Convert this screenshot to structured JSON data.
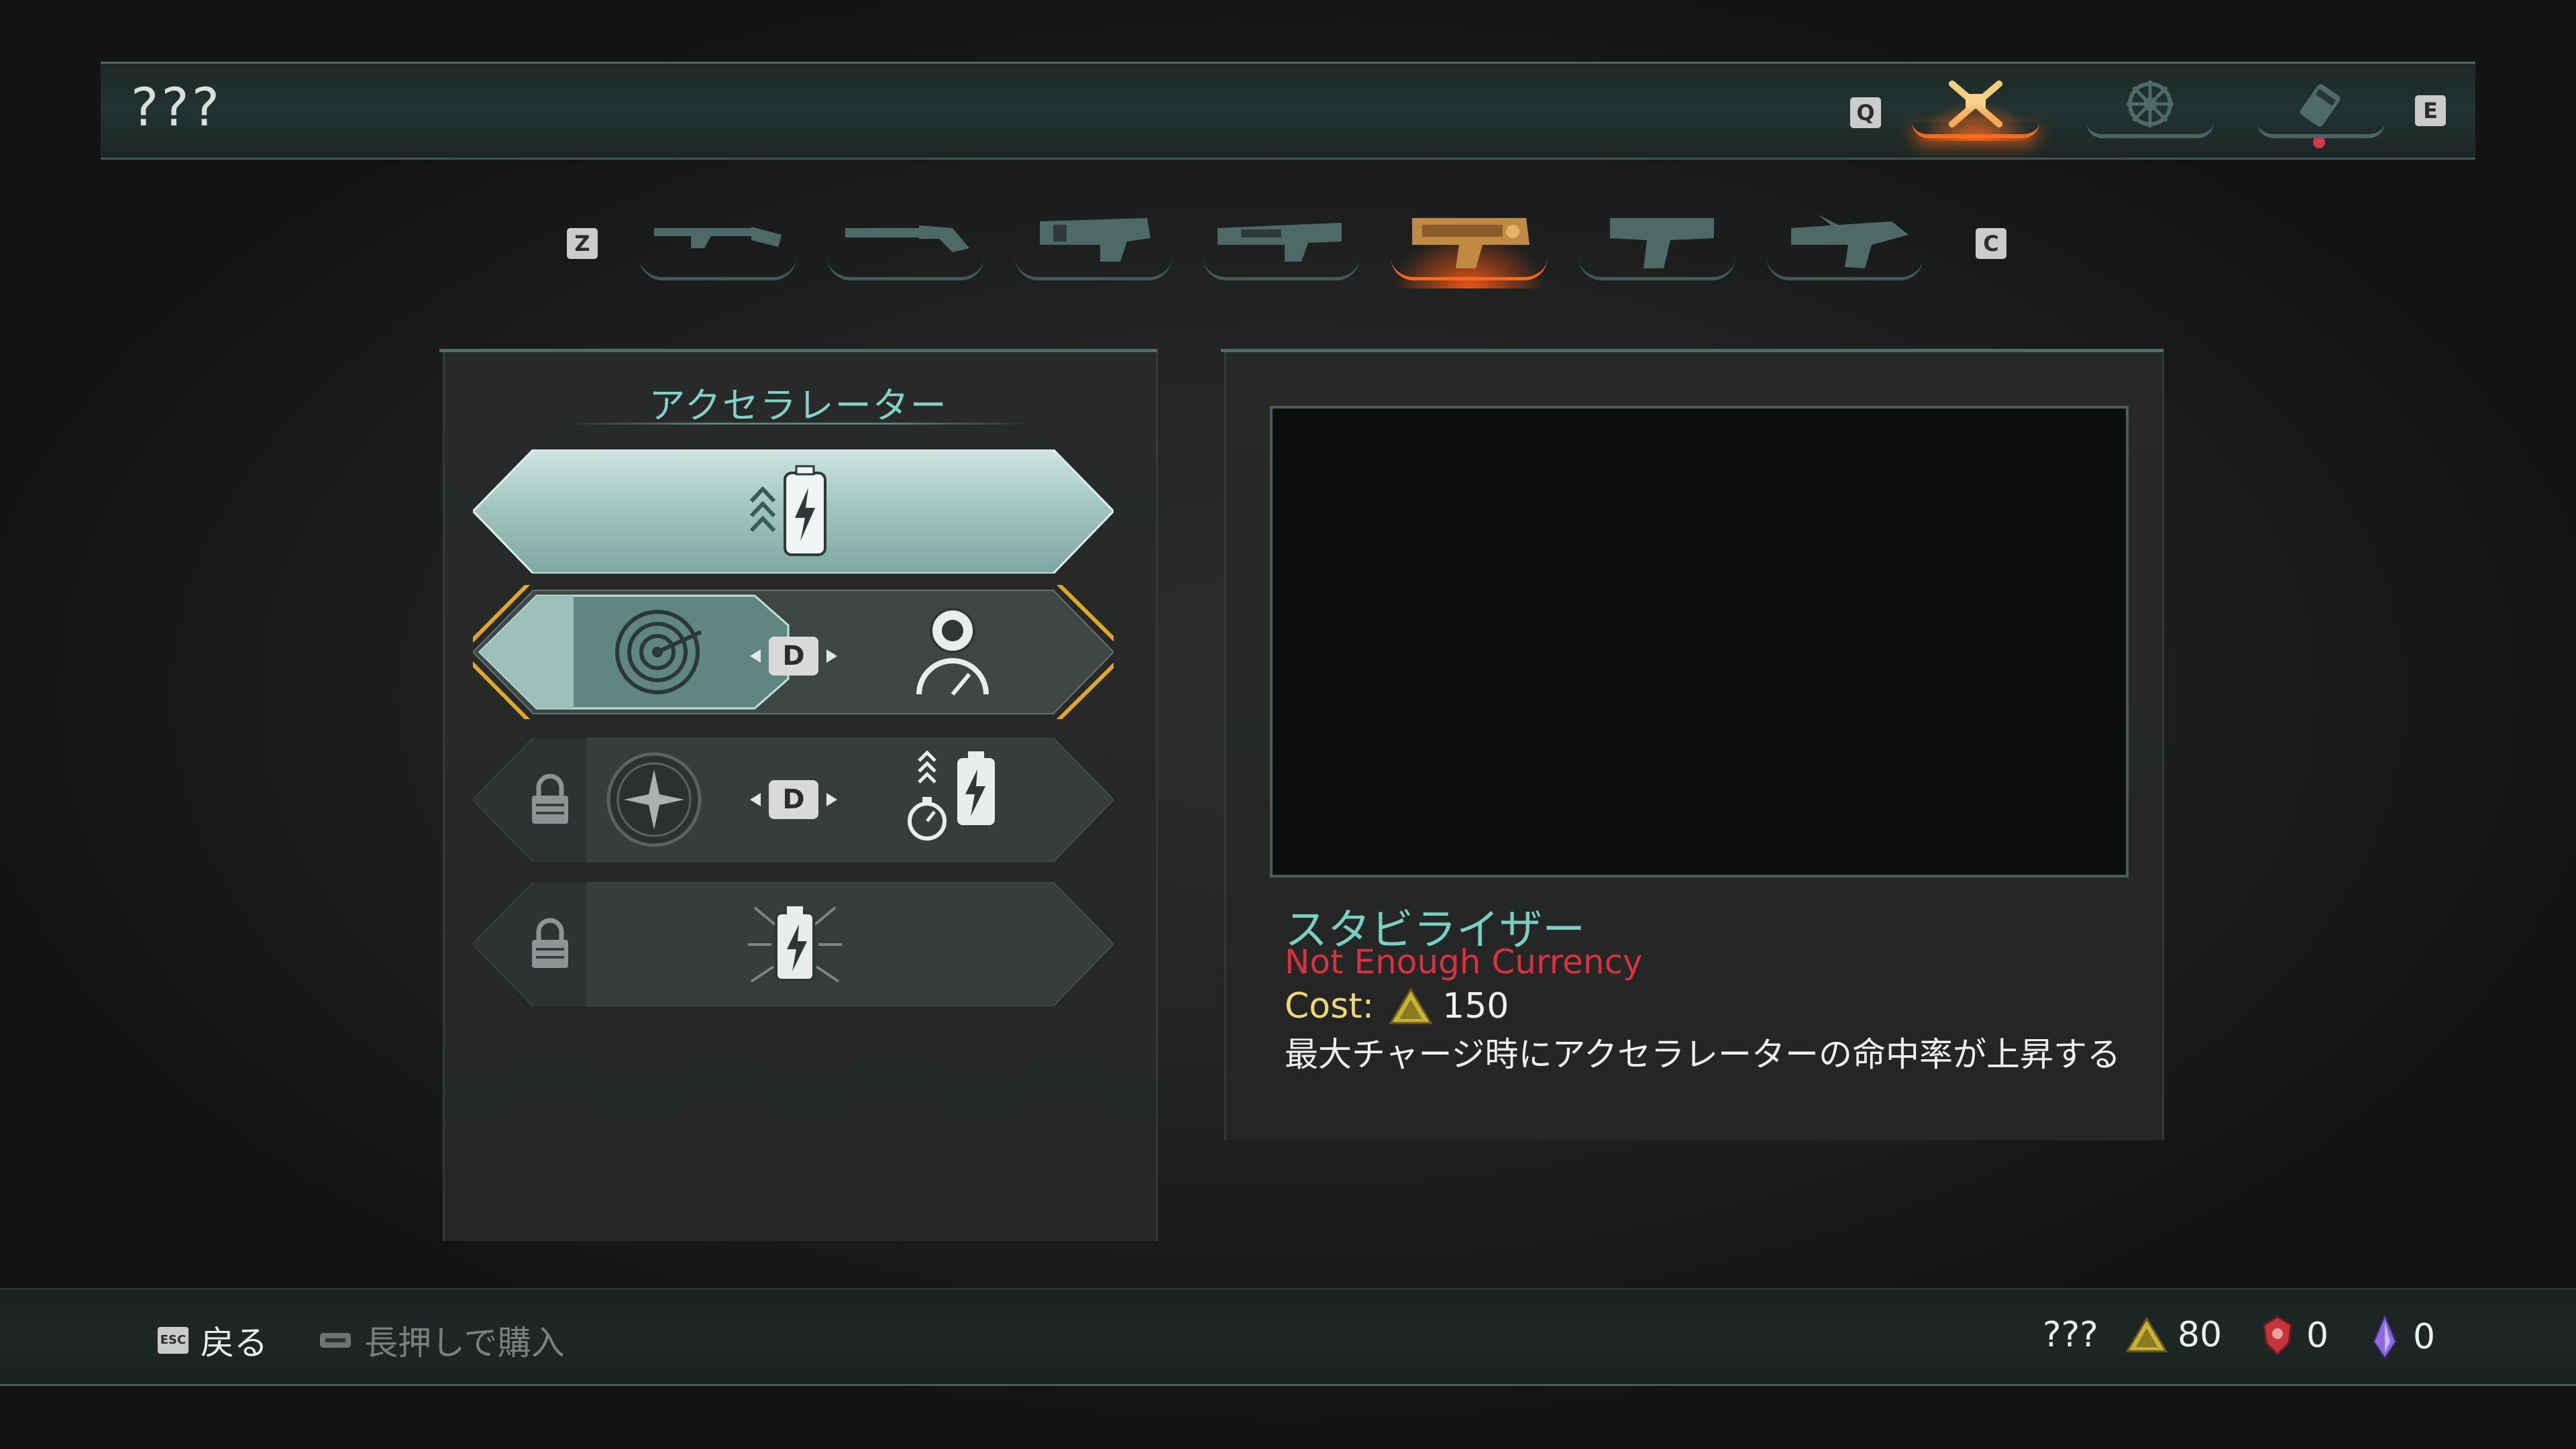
{
  "header": {
    "title": "???",
    "prev_key": "Q",
    "next_key": "E",
    "categories": [
      {
        "name": "weapons",
        "icon": "crossed-guns-icon",
        "active": true
      },
      {
        "name": "mods",
        "icon": "gear-wheel-icon",
        "active": false
      },
      {
        "name": "items",
        "icon": "rocket-icon",
        "active": false
      }
    ]
  },
  "weapon_bar": {
    "prev_key": "Z",
    "next_key": "C",
    "weapons": [
      {
        "icon": "shotgun-icon",
        "active": false
      },
      {
        "icon": "revolver-icon",
        "active": false
      },
      {
        "icon": "heavy-rifle-icon",
        "active": false
      },
      {
        "icon": "assault-rifle-icon",
        "active": false
      },
      {
        "icon": "accelerator-gun-icon",
        "active": true
      },
      {
        "icon": "pistol-icon",
        "active": false
      },
      {
        "icon": "blaster-icon",
        "active": false
      }
    ]
  },
  "upgrade_panel": {
    "title": "アクセラレーター",
    "choice_key": "D",
    "rows": [
      {
        "state": "owned",
        "icon": "charge-battery-up-icon"
      },
      {
        "state": "selected",
        "left_icon": "target-dart-icon",
        "right_icon": "stabilizer-gauge-icon"
      },
      {
        "state": "locked",
        "left_icon": "burst-compass-icon",
        "right_icon": "timer-battery-icon"
      },
      {
        "state": "locked",
        "icon": "overcharge-battery-icon"
      }
    ]
  },
  "details": {
    "name": "スタビライザー",
    "warning": "Not Enough Currency",
    "cost_label": "Cost:",
    "cost_value": "150",
    "description": "最大チャージ時にアクセラレーターの命中率が上昇する"
  },
  "footer": {
    "back_key": "ESC",
    "back_label": "戻る",
    "buy_label": "長押しで購入",
    "currency_label": "???",
    "currencies": [
      {
        "icon": "gold-triangle-coin-icon",
        "value": "80",
        "color": "#d9c23c"
      },
      {
        "icon": "red-crest-icon",
        "value": "0",
        "color": "#d33a3a"
      },
      {
        "icon": "purple-crystal-icon",
        "value": "0",
        "color": "#8e6be0"
      }
    ]
  },
  "colors": {
    "accent_teal": "#79cfc2",
    "accent_orange": "#ff6b1a",
    "warning_red": "#d8313f",
    "cost_gold": "#f1d775"
  }
}
